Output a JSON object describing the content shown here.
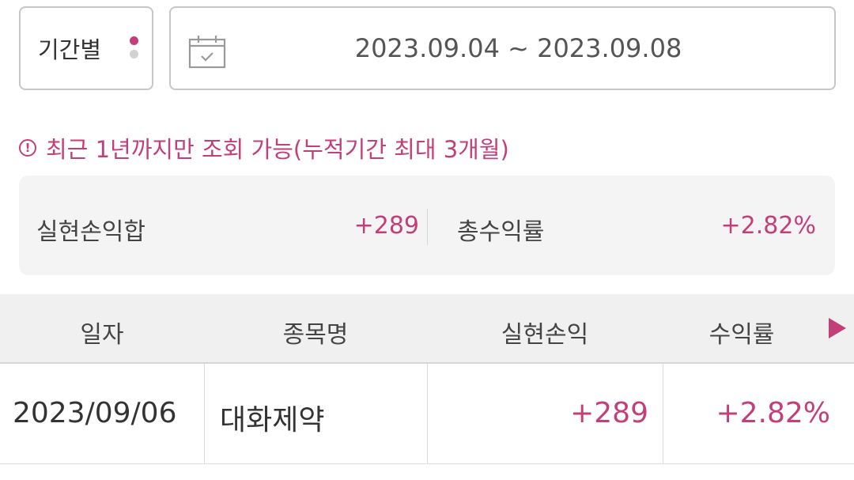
{
  "filter": {
    "period_label": "기간별",
    "date_range": "2023.09.04 ~ 2023.09.08"
  },
  "notice": {
    "icon": "info-circle-icon",
    "text": "최근 1년까지만 조회 가능(누적기간 최대 3개월)"
  },
  "summary": {
    "realized_pl_label": "실현손익합",
    "realized_pl_value": "+289",
    "total_return_label": "총수익률",
    "total_return_value": "+2.82%"
  },
  "table": {
    "headers": [
      "일자",
      "종목명",
      "실현손익",
      "수익률"
    ],
    "rows": [
      {
        "date": "2023/09/06",
        "name": "대화제약",
        "realized_pl": "+289",
        "return_rate": "+2.82%"
      }
    ]
  },
  "colors": {
    "accent": "#c33f7a",
    "border": "#c6c6c6",
    "summary_bg": "#f4f4f4",
    "header_bg": "#f0f0f0"
  }
}
